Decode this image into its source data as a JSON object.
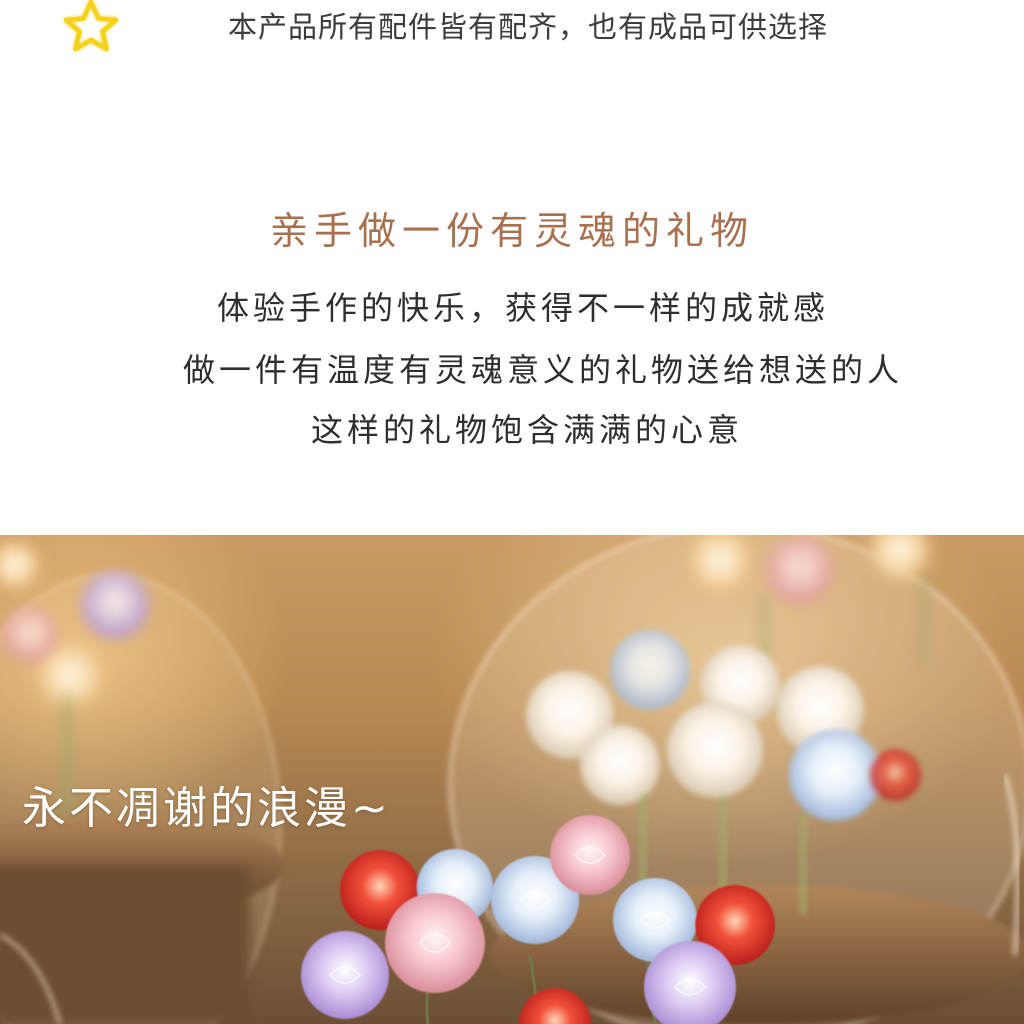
{
  "note": {
    "icon": "star-outline-icon",
    "icon_color": "#f2d21b",
    "text": "本产品所有配件皆有配齐，也有成品可供选择"
  },
  "headline": {
    "text": "亲手做一份有灵魂的礼物",
    "color": "#a9704f"
  },
  "body_lines": [
    "体验手作的快乐，获得不一样的成就感",
    "做一件有温度有灵魂意义的礼物送给想送的人",
    "这样的礼物饱含满满的心意"
  ],
  "photo": {
    "caption": "永不凋谢的浪漫~",
    "subject": "glowing-crystal-rose-lamps"
  }
}
